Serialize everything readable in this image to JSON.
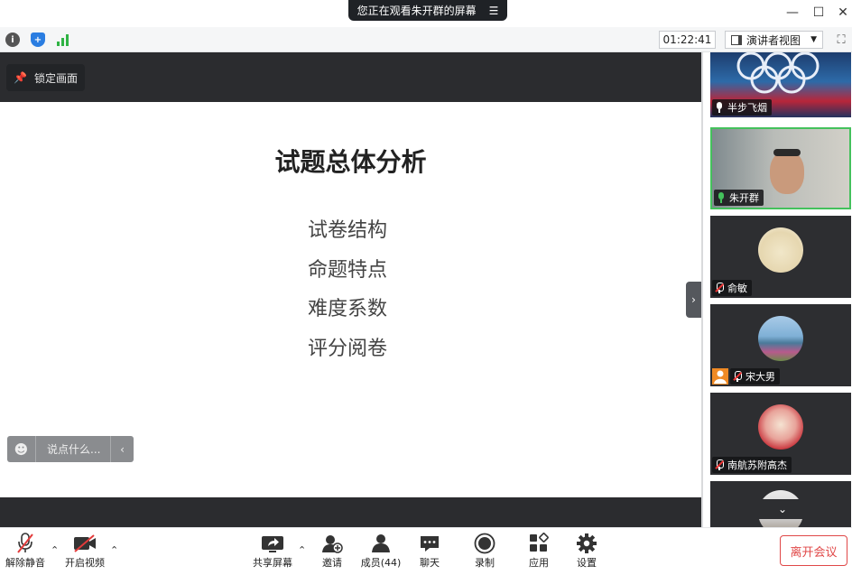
{
  "window": {
    "sharing_banner": "您正在观看朱开群的屏幕",
    "banner_menu_icon": "menu-icon",
    "controls": [
      "minimize-icon",
      "maximize-icon",
      "close-icon"
    ]
  },
  "statusbar": {
    "icons": [
      "info-icon",
      "shield-icon",
      "signal-icon"
    ],
    "timer": "01:22:41",
    "view_mode": "演讲者视图",
    "colors": {
      "shield": "#2a7de1",
      "signal": "#2fb344",
      "info": "#555555"
    }
  },
  "share": {
    "lock_label": "锁定画面",
    "slide": {
      "title": "试题总体分析",
      "items": [
        "试卷结构",
        "命题特点",
        "难度系数",
        "评分阅卷"
      ]
    },
    "chat_placeholder": "说点什么..."
  },
  "participants": [
    {
      "name": "半步飞烟",
      "mic": "on"
    },
    {
      "name": "朱开群",
      "mic": "active"
    },
    {
      "name": "俞敏",
      "mic": "muted"
    },
    {
      "name": "宋大男",
      "mic": "muted"
    },
    {
      "name": "南航苏附高杰",
      "mic": "muted"
    }
  ],
  "toolbar": {
    "unmute": "解除静音",
    "start_video": "开启视频",
    "share_screen": "共享屏幕",
    "invite": "邀请",
    "members": "成员(44)",
    "chat": "聊天",
    "record": "录制",
    "apps": "应用",
    "settings": "设置",
    "leave": "离开会议",
    "accent_color": "#e04848"
  }
}
